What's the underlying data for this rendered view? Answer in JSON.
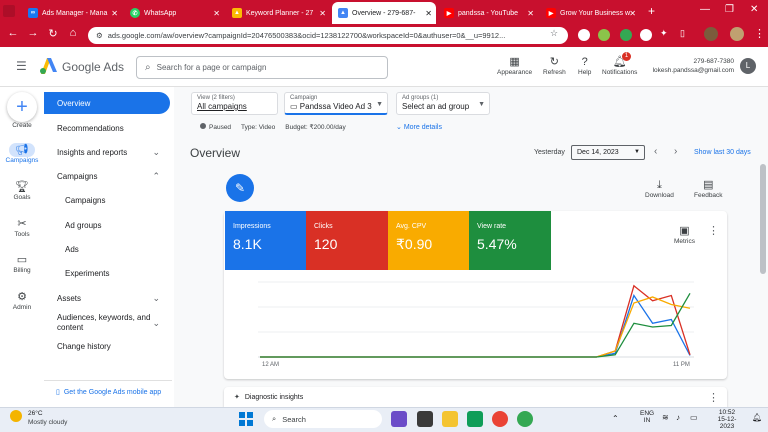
{
  "browser": {
    "tabs": [
      {
        "label": "Ads Manager - Mana",
        "favicon": "meta-icon",
        "active": false
      },
      {
        "label": "WhatsApp",
        "favicon": "whatsapp-icon",
        "active": false
      },
      {
        "label": "Keyword Planner - 27",
        "favicon": "google-ads-icon",
        "active": false
      },
      {
        "label": "Overview - 279-687-",
        "favicon": "google-ads-icon",
        "active": true
      },
      {
        "label": "pandssa - YouTube",
        "favicon": "youtube-icon",
        "active": false
      },
      {
        "label": "Grow Your Business w",
        "favicon": "youtube-icon",
        "active": false
      }
    ],
    "new_tab": "+",
    "url": "ads.google.com/aw/overview?campaignId=20476500383&ocid=1238122700&workspaceId=0&authuser=0&__u=9912..."
  },
  "header": {
    "product": "Google Ads",
    "search_placeholder": "Search for a page or campaign",
    "tools": [
      "Appearance",
      "Refresh",
      "Help",
      "Notifications"
    ],
    "notification_count": "1",
    "account_id": "279-687-7380",
    "account_email": "lokesh.pandssa@gmail.com",
    "avatar_letter": "L"
  },
  "rail": {
    "create": "Create",
    "items": [
      "Campaigns",
      "Goals",
      "Tools",
      "Billing",
      "Admin"
    ]
  },
  "sidebar": {
    "overview": "Overview",
    "recommendations": "Recommendations",
    "insights": "Insights and reports",
    "campaigns": "Campaigns",
    "sub": [
      "Campaigns",
      "Ad groups",
      "Ads",
      "Experiments"
    ],
    "assets": "Assets",
    "audiences": "Audiences, keywords, and content",
    "change_history": "Change history",
    "mobile_app": "Get the Google Ads mobile app"
  },
  "filters": {
    "view_label": "View (2 filters)",
    "view_value": "All campaigns",
    "campaign_label": "Campaign",
    "campaign_value": "Pandssa Video Ad 3",
    "adgroup_label": "Ad groups (1)",
    "adgroup_value": "Select an ad group",
    "status": "Paused",
    "type": "Type: Video",
    "budget": "Budget: ₹200.00/day",
    "more": "More details"
  },
  "overview": {
    "title": "Overview",
    "yesterday": "Yesterday",
    "date": "Dec 14, 2023",
    "show_last": "Show last 30 days",
    "download": "Download",
    "feedback": "Feedback",
    "metrics_label": "Metrics",
    "x_start": "12 AM",
    "x_end": "11 PM",
    "diagnostic": "Diagnostic insights"
  },
  "metrics": [
    {
      "label": "Impressions",
      "value": "8.1K",
      "color": "#1a73e8"
    },
    {
      "label": "Clicks",
      "value": "120",
      "color": "#d93025"
    },
    {
      "label": "Avg. CPV",
      "value": "₹0.90",
      "color": "#f9ab00"
    },
    {
      "label": "View rate",
      "value": "5.47%",
      "color": "#1e8e3e"
    }
  ],
  "chart_data": {
    "type": "line",
    "x": [
      "12 AM",
      "",
      "",
      "",
      "",
      "",
      "",
      "",
      "",
      "",
      "",
      "",
      "",
      "",
      "",
      "",
      "",
      "",
      "",
      "",
      "",
      "",
      "",
      "11 PM"
    ],
    "ylim": [
      0,
      1
    ],
    "series": [
      {
        "color": "#1a73e8",
        "values": [
          0,
          0,
          0,
          0,
          0,
          0,
          0,
          0,
          0,
          0,
          0,
          0,
          0,
          0,
          0,
          0,
          0,
          0,
          0,
          0.05,
          0.82,
          0.45,
          0.5,
          0.02
        ]
      },
      {
        "color": "#d93025",
        "values": [
          0,
          0,
          0,
          0,
          0,
          0,
          0,
          0,
          0,
          0,
          0,
          0,
          0,
          0,
          0,
          0,
          0,
          0,
          0,
          0.08,
          0.95,
          0.75,
          0.82,
          0.03
        ]
      },
      {
        "color": "#f9ab00",
        "values": [
          0,
          0,
          0,
          0,
          0,
          0,
          0,
          0,
          0,
          0,
          0,
          0,
          0,
          0,
          0,
          0,
          0,
          0,
          0,
          0.08,
          0.72,
          0.8,
          0.7,
          0.65
        ]
      },
      {
        "color": "#1e8e3e",
        "values": [
          0,
          0,
          0,
          0,
          0,
          0,
          0,
          0,
          0,
          0,
          0,
          0,
          0,
          0,
          0,
          0,
          0,
          0,
          0,
          0.03,
          0.45,
          0.4,
          0.42,
          0.85
        ]
      }
    ]
  },
  "taskbar": {
    "temp": "26°C",
    "weather": "Mostly cloudy",
    "search": "Search",
    "lang1": "ENG",
    "lang2": "IN",
    "time": "10:52",
    "date": "15-12-2023"
  }
}
